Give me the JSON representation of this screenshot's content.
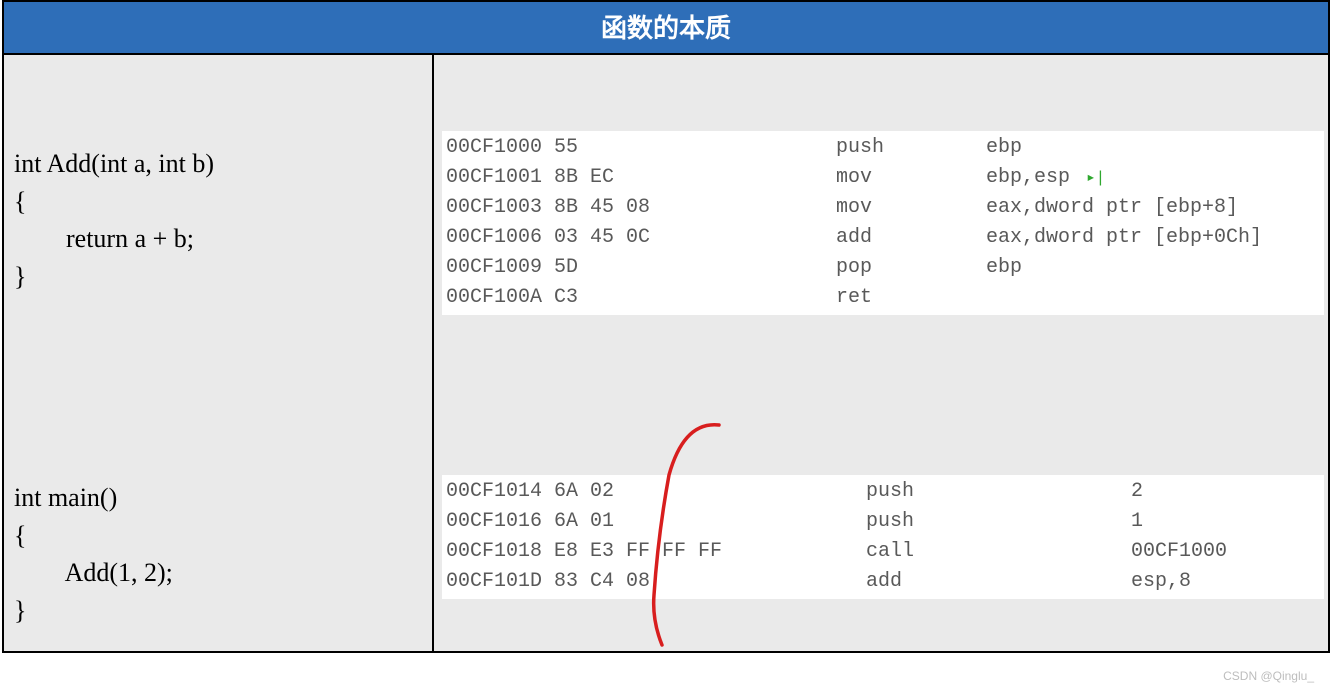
{
  "header": {
    "title": "函数的本质"
  },
  "source": {
    "add_func": "int Add(int a, int b)\n{\n        return a + b;\n}",
    "main_func": "int main()\n{\n        Add(1, 2);\n}"
  },
  "asm_add": [
    {
      "addr_bytes": "00CF1000 55",
      "op": "push",
      "args": "ebp"
    },
    {
      "addr_bytes": "00CF1001 8B EC",
      "op": "mov",
      "args": "ebp,esp",
      "marker": true
    },
    {
      "addr_bytes": "00CF1003 8B 45 08",
      "op": "mov",
      "args": "eax,dword ptr [ebp+8]"
    },
    {
      "addr_bytes": "00CF1006 03 45 0C",
      "op": "add",
      "args": "eax,dword ptr [ebp+0Ch]"
    },
    {
      "addr_bytes": "00CF1009 5D",
      "op": "pop",
      "args": "ebp"
    },
    {
      "addr_bytes": "00CF100A C3",
      "op": "ret",
      "args": ""
    }
  ],
  "asm_main": [
    {
      "addr_bytes": "00CF1014 6A 02",
      "op": "push",
      "args": "2"
    },
    {
      "addr_bytes": "00CF1016 6A 01",
      "op": "push",
      "args": "1"
    },
    {
      "addr_bytes": "00CF1018 E8 E3 FF FF FF",
      "op": "call",
      "args": "00CF1000"
    },
    {
      "addr_bytes": "00CF101D 83 C4 08",
      "op": "add",
      "args": "esp,8"
    }
  ],
  "watermark": "CSDN @Qinglu_"
}
